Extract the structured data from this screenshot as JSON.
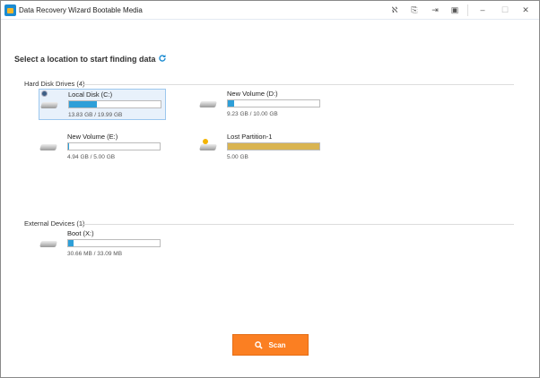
{
  "window": {
    "title": "Data Recovery Wizard Bootable Media"
  },
  "heading": "Select a location to start finding data",
  "sections": {
    "hdd": {
      "label": "Hard Disk Drives (4)",
      "drives": [
        {
          "name": "Local Disk (C:)",
          "size": "13.83 GB / 19.99 GB",
          "used_fraction": 0.3,
          "selected": true
        },
        {
          "name": "New Volume (D:)",
          "size": "9.23 GB / 10.00 GB",
          "used_fraction": 0.07
        },
        {
          "name": "New Volume (E:)",
          "size": "4.94 GB / 5.00 GB",
          "used_fraction": 0.01
        },
        {
          "name": "Lost Partition-1",
          "size": "5.00 GB",
          "used_fraction": 1.0,
          "bar_color": "#d9b451"
        }
      ]
    },
    "external": {
      "label": "External Devices (1)",
      "drives": [
        {
          "name": "Boot (X:)",
          "size": "30.66 MB / 33.09 MB",
          "used_fraction": 0.06
        }
      ]
    }
  },
  "scan_button": {
    "label": "Scan",
    "color": "#fb7f22"
  },
  "colors": {
    "accent": "#2e9fd8"
  }
}
